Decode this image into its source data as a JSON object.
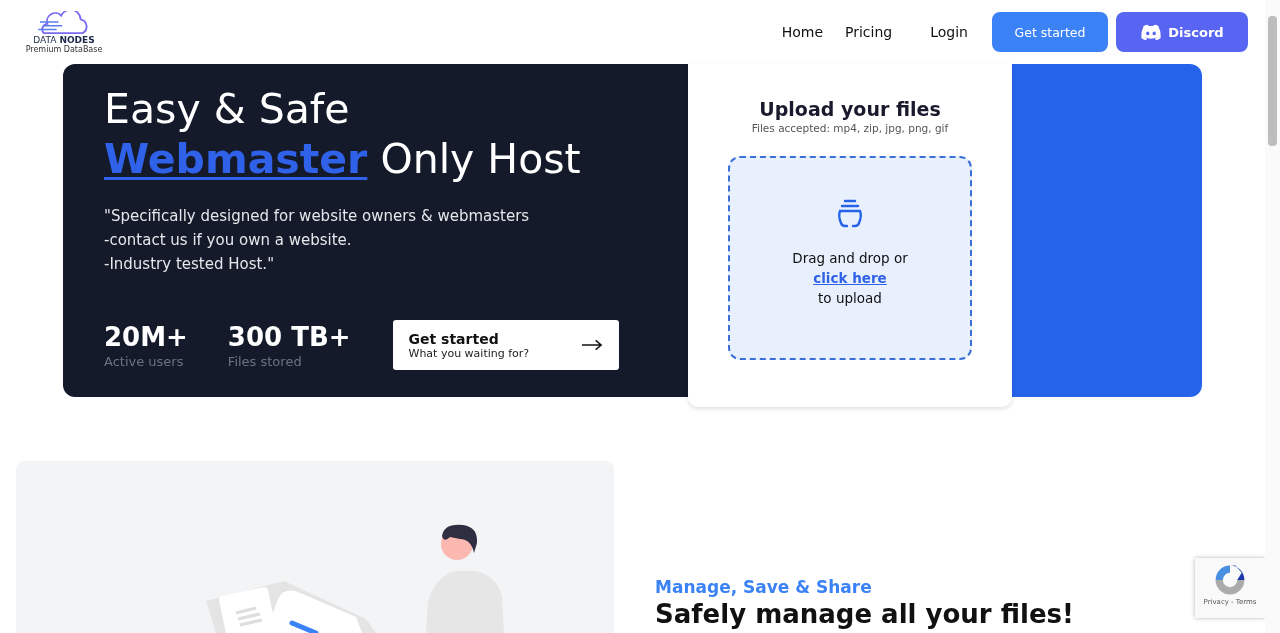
{
  "logo": {
    "brand_light": "DATA",
    "brand_bold": "NODES",
    "tagline": "Premium DataBase"
  },
  "nav": [
    {
      "label": "Home"
    },
    {
      "label": "Pricing"
    },
    {
      "label": "Login"
    }
  ],
  "header_buttons": [
    {
      "kind": "primary",
      "label": "Get started"
    },
    {
      "kind": "discord",
      "label": "Discord"
    }
  ],
  "hero": {
    "title_line": "Easy & Safe",
    "highlight": "Webmaster",
    "title_rest": "Only Host",
    "quote": [
      "\"Specifically designed for website owners & webmasters",
      "-contact us if you own a website.",
      "-Industry tested Host.\""
    ],
    "stats": [
      {
        "value": "20M+",
        "label": "Active users"
      },
      {
        "value": "300 TB+",
        "label": "Files stored"
      }
    ],
    "cta": {
      "title": "Get started",
      "subtitle": "What you waiting for?"
    }
  },
  "upload": {
    "title": "Upload your files",
    "subtitle": "Files accepted: mp4, zip, jpg, png, gif",
    "drop_text": "Drag and drop or",
    "link": "click here",
    "after": "to upload"
  },
  "feature": {
    "eyebrow": "Manage, Save & Share",
    "heading": "Safely manage all your files!"
  },
  "recaptcha": {
    "links": "Privacy - Terms"
  }
}
